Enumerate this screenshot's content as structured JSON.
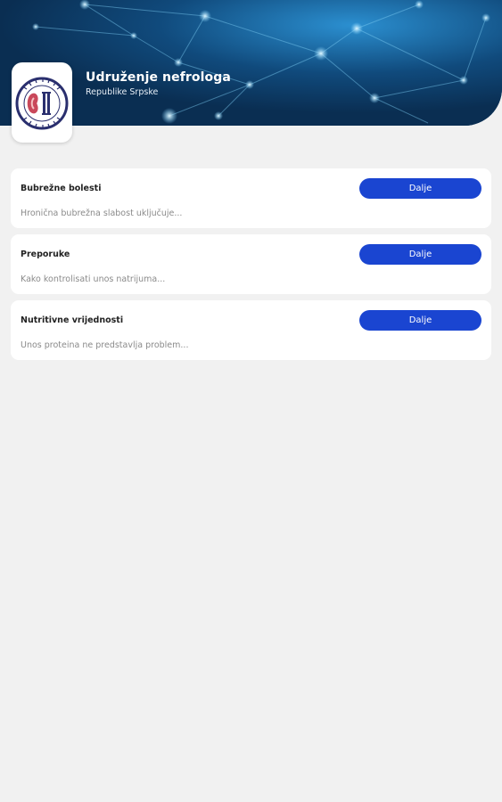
{
  "header": {
    "title": "Udruženje nefrologa",
    "subtitle": "Republike Srpske",
    "logo_icon": "kidney-association-logo",
    "background_icon": "network-nodes-background"
  },
  "colors": {
    "header_bg": "#0b3a63",
    "accent": "#1a45d1",
    "page_bg": "#f1f1f1"
  },
  "cards": [
    {
      "title": "Bubrežne bolesti",
      "description": "Hronična bubrežna slabost uključuje...",
      "button_label": "Dalje"
    },
    {
      "title": "Preporuke",
      "description": "Kako kontrolisati unos natrijuma...",
      "button_label": "Dalje"
    },
    {
      "title": "Nutritivne vrijednosti",
      "description": "Unos proteina ne predstavlja problem...",
      "button_label": "Dalje"
    }
  ]
}
